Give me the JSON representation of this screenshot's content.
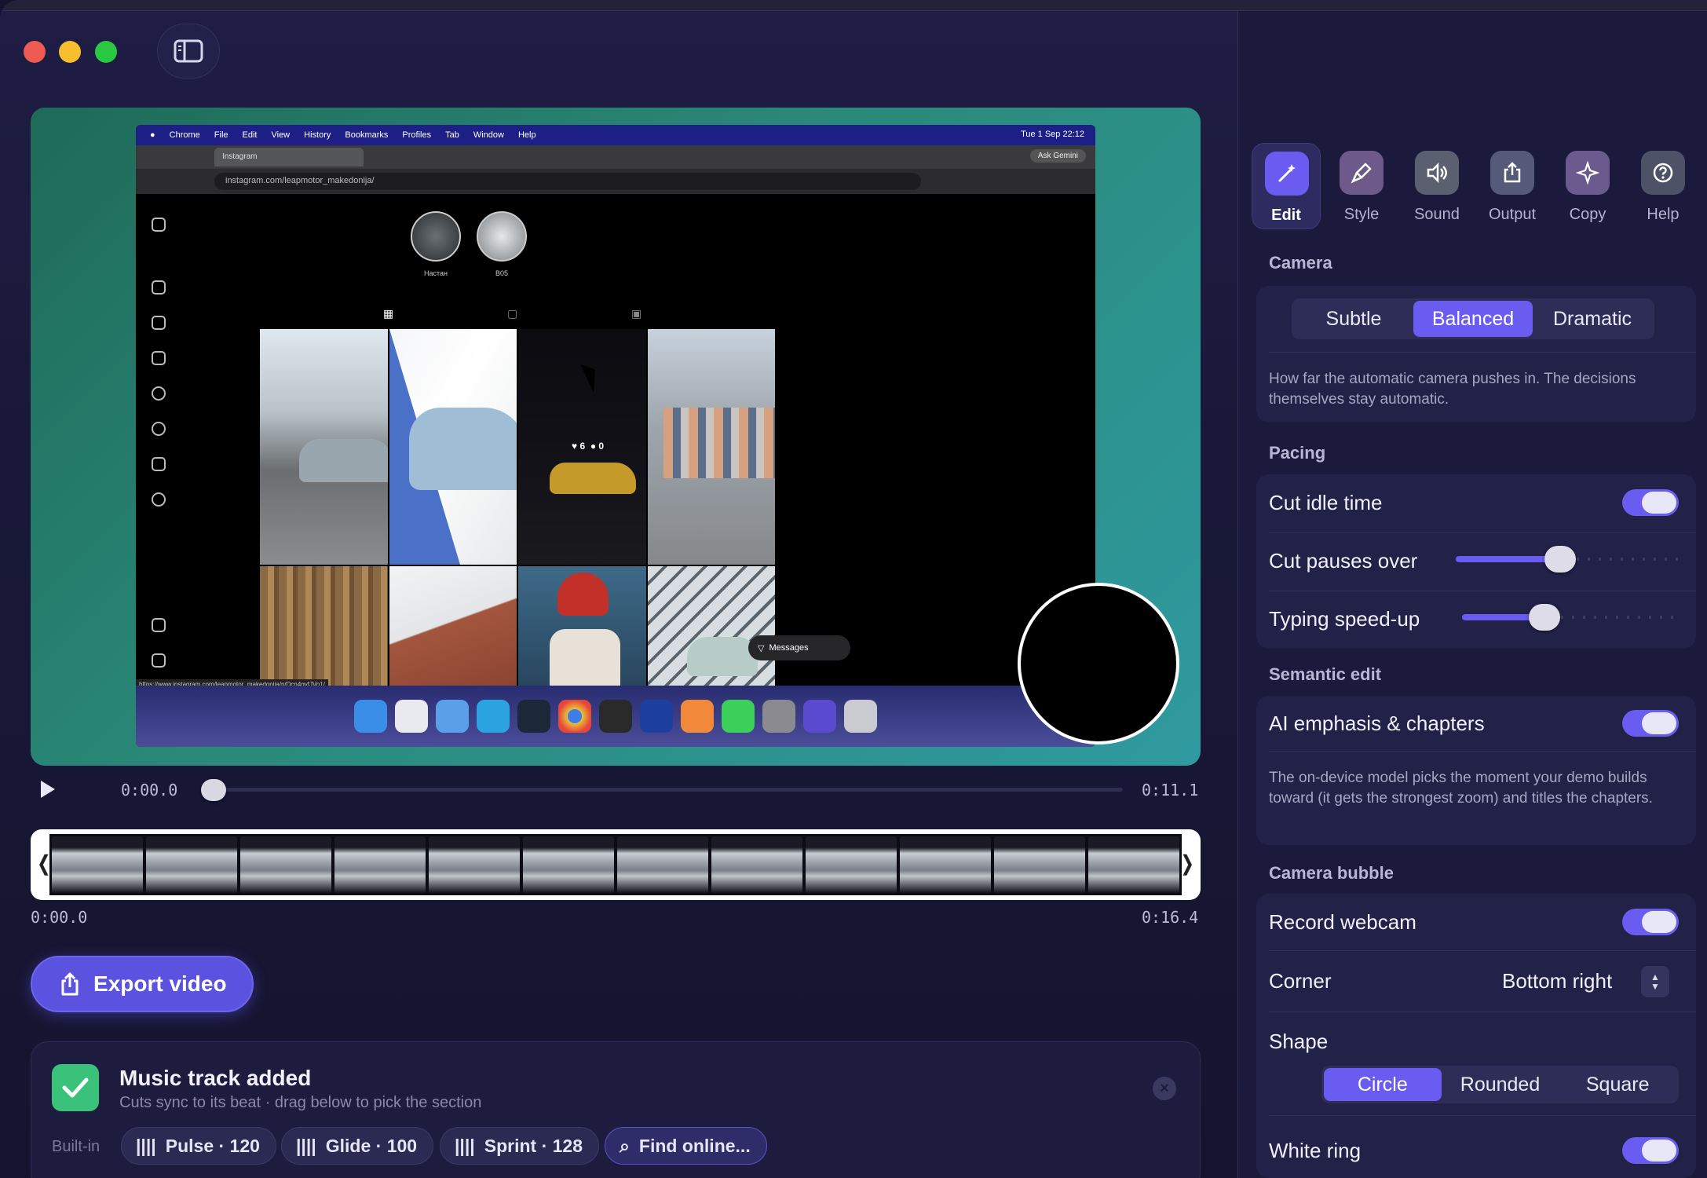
{
  "window": {
    "controls": [
      "close",
      "minimize",
      "zoom"
    ],
    "sidebar_toggle_icon": "sidebar-icon"
  },
  "preview": {
    "browser": {
      "menubar_items": [
        "Chrome",
        "File",
        "Edit",
        "View",
        "History",
        "Bookmarks",
        "Profiles",
        "Tab",
        "Window",
        "Help"
      ],
      "clock": "Tue 1 Sep 22:12",
      "tab_title": "Instagram",
      "ask_gemini": "Ask Gemini",
      "url": "instagram.com/leapmotor_makedonija/",
      "status_url": "https://www.instagram.com/leapmotor_makedonija/p/Dcn4gvfJVo1/"
    },
    "stories": [
      "Настан",
      "B05"
    ],
    "post_stats": {
      "likes": "6",
      "comments": "0"
    },
    "messages_label": "Messages"
  },
  "player": {
    "current_time": "0:00.0",
    "duration": "0:11.1",
    "progress": 0.0
  },
  "filmstrip": {
    "start_time": "0:00.0",
    "end_time": "0:16.4",
    "left_handle": "❬",
    "right_handle": "❭"
  },
  "export_button": {
    "label": "Export video",
    "icon": "share-icon"
  },
  "toast": {
    "title": "Music track added",
    "subtitle": "Cuts sync to its beat · drag below to pick the section",
    "builtin_label": "Built-in",
    "tracks": [
      "Pulse · 120",
      "Glide · 100",
      "Sprint · 128"
    ],
    "find_online": "Find online..."
  },
  "panel": {
    "tabs": [
      {
        "label": "Edit",
        "icon": "magic-wand-icon",
        "active": true
      },
      {
        "label": "Style",
        "icon": "brush-icon",
        "active": false
      },
      {
        "label": "Sound",
        "icon": "speaker-icon",
        "active": false
      },
      {
        "label": "Output",
        "icon": "share-icon",
        "active": false
      },
      {
        "label": "Copy",
        "icon": "sparkle-icon",
        "active": false
      },
      {
        "label": "Help",
        "icon": "question-icon",
        "active": false
      }
    ],
    "camera": {
      "heading": "Camera",
      "options": [
        "Subtle",
        "Balanced",
        "Dramatic"
      ],
      "selected": "Balanced",
      "help": "How far the automatic camera pushes in. The decisions themselves stay automatic."
    },
    "pacing": {
      "heading": "Pacing",
      "cut_idle_time": {
        "label": "Cut idle time",
        "on": true
      },
      "cut_pauses_over": {
        "label": "Cut pauses over",
        "level": 0.47
      },
      "typing_speed_up": {
        "label": "Typing speed-up",
        "level": 0.38
      }
    },
    "semantic": {
      "heading": "Semantic edit",
      "ai_emphasis": {
        "label": "AI emphasis & chapters",
        "on": true
      },
      "help": "The on-device model picks the moment your demo builds toward (it gets the strongest zoom) and titles the chapters."
    },
    "bubble": {
      "heading": "Camera bubble",
      "record_webcam": {
        "label": "Record webcam",
        "on": true
      },
      "corner_label": "Corner",
      "corner_value": "Bottom right",
      "shape_label": "Shape",
      "shapes": [
        "Circle",
        "Rounded",
        "Square"
      ],
      "shape_selected": "Circle",
      "white_ring": {
        "label": "White ring",
        "on": true
      }
    }
  },
  "colors": {
    "accent": "#6a5cf0",
    "background": "#15142f",
    "panel": "#1b1a3c",
    "success": "#3ac27a"
  }
}
